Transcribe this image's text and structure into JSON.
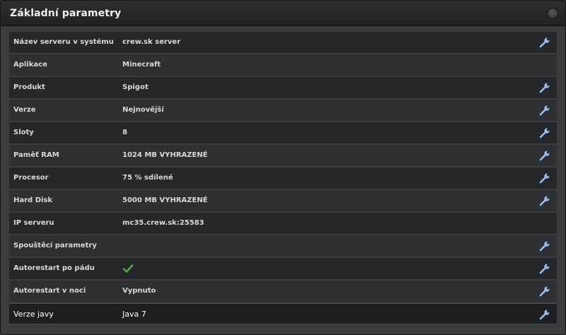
{
  "panel": {
    "title": "Základní parametry"
  },
  "colors": {
    "wrench": "#9cc0e8",
    "check": "#4caf3c"
  },
  "rows": [
    {
      "label": "Název serveru v systému",
      "value": "crew.sk server",
      "editable": true,
      "icon": "wrench-icon"
    },
    {
      "label": "Aplikace",
      "value": "Minecraft",
      "editable": false
    },
    {
      "label": "Produkt",
      "value": "Spigot",
      "editable": true,
      "icon": "wrench-icon"
    },
    {
      "label": "Verze",
      "value": "Nejnovější",
      "editable": true,
      "icon": "wrench-icon"
    },
    {
      "label": "Sloty",
      "value": "8",
      "editable": true,
      "icon": "wrench-icon"
    },
    {
      "label": "Paměť RAM",
      "value": "1024 MB VYHRAZENÉ",
      "editable": true,
      "icon": "wrench-icon"
    },
    {
      "label": "Procesor",
      "value": "75 % sdílené",
      "editable": true,
      "icon": "wrench-icon"
    },
    {
      "label": "Hard Disk",
      "value": "5000 MB VYHRAZENÉ",
      "editable": true,
      "icon": "wrench-icon"
    },
    {
      "label": "IP serveru",
      "value": "mc35.crew.sk:25583",
      "editable": false
    },
    {
      "label": "Spouštěcí parametry",
      "value": "",
      "editable": true,
      "icon": "wrench-icon"
    },
    {
      "label": "Autorestart po pádu",
      "value": "",
      "checked": true,
      "editable": true,
      "icon": "wrench-icon"
    },
    {
      "label": "Autorestart v noci",
      "value": "Vypnuto",
      "editable": true,
      "icon": "wrench-icon"
    },
    {
      "label": "Verze javy",
      "value": "Java 7",
      "editable": true,
      "icon": "wrench-icon"
    }
  ]
}
